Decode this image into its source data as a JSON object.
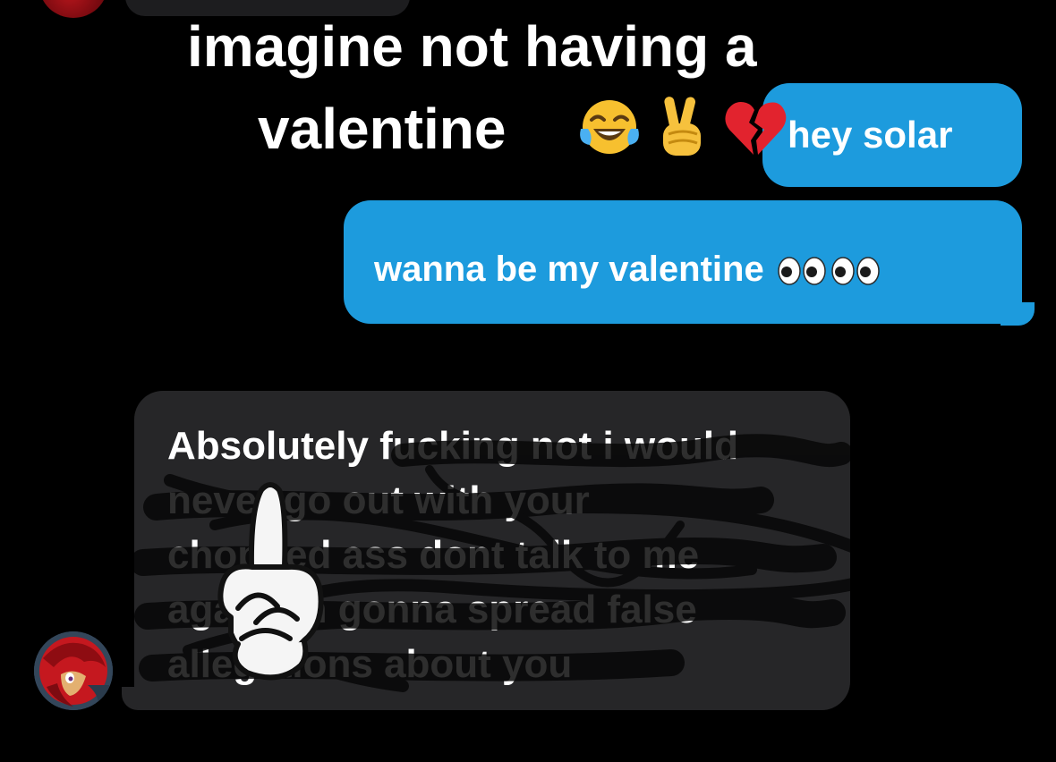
{
  "caption": {
    "line1": "imagine not having a",
    "line2": "valentine",
    "emojis": [
      "face-with-tears-of-joy-icon",
      "victory-hand-icon",
      "broken-heart-icon"
    ]
  },
  "messages": {
    "outgoing": [
      {
        "text": "hey solar"
      },
      {
        "text": "wanna be my valentine",
        "trailing_icons": [
          "eyes-icon",
          "eyes-icon"
        ]
      }
    ],
    "incoming": {
      "lines": [
        "Absolutely fucking not i would",
        "never go out with your",
        "chopped ass dont talk to me",
        "again im gonna spread false",
        "allegations about you"
      ],
      "overlay_icon": "middle-finger-icon"
    }
  },
  "colors": {
    "background": "#000000",
    "outgoing_bubble": "#1d9bdd",
    "incoming_bubble": "#262628",
    "text": "#ffffff"
  }
}
